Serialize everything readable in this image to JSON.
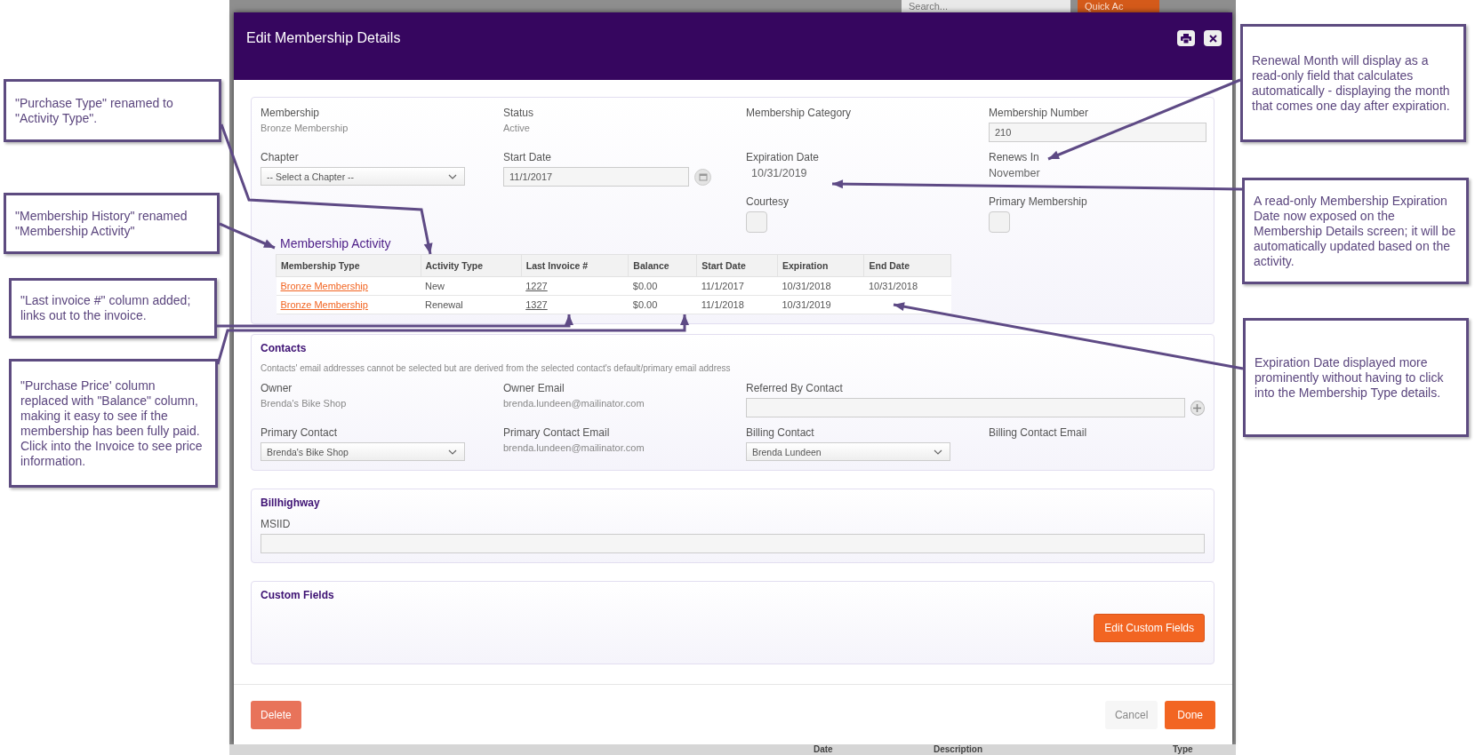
{
  "background": {
    "search_placeholder": "Search...",
    "quick_action": "Quick Ac",
    "table_headers": [
      "Date",
      "Description",
      "Type"
    ]
  },
  "modal": {
    "title": "Edit Membership Details"
  },
  "membership": {
    "rows": [
      [
        {
          "kind": "text",
          "label": "Membership",
          "value": "Bronze Membership"
        },
        {
          "kind": "text",
          "label": "Status",
          "value": "Active"
        },
        {
          "kind": "label",
          "label": "Membership Category"
        },
        {
          "kind": "input",
          "label": "Membership Number",
          "value": "210"
        }
      ],
      [
        {
          "kind": "select",
          "label": "Chapter",
          "value": "-- Select a Chapter --"
        },
        {
          "kind": "date",
          "label": "Start Date",
          "value": "11/1/2017"
        },
        {
          "kind": "readonly",
          "label": "Expiration Date",
          "value": "10/31/2019"
        },
        {
          "kind": "readonly",
          "label": "Renews In",
          "value": "November"
        }
      ],
      [
        "",
        "",
        {
          "kind": "checkbox",
          "label": "Courtesy",
          "checked": false
        },
        {
          "kind": "checkbox",
          "label": "Primary Membership",
          "checked": false
        }
      ]
    ]
  },
  "activity": {
    "title": "Membership Activity",
    "columns": [
      {
        "label": "Membership Type",
        "kind": "link"
      },
      {
        "label": "Activity Type",
        "kind": "text"
      },
      {
        "label": "Last Invoice #",
        "kind": "link"
      },
      {
        "label": "Balance",
        "kind": "text"
      },
      {
        "label": "Start Date",
        "kind": "text"
      },
      {
        "label": "Expiration",
        "kind": "text"
      },
      {
        "label": "End Date",
        "kind": "text"
      }
    ],
    "rows": [
      [
        "Bronze Membership",
        "New",
        "1227",
        "$0.00",
        "11/1/2017",
        "10/31/2018",
        "10/31/2018"
      ],
      [
        "Bronze Membership",
        "Renewal",
        "1327",
        "$0.00",
        "11/1/2018",
        "10/31/2019"
      ]
    ]
  },
  "contacts": {
    "title": "Contacts",
    "note": "Contacts' email addresses cannot be selected but are derived from the selected contact's default/primary email address",
    "rows": [
      [
        {
          "kind": "text",
          "label": "Owner",
          "value": "Brenda's Bike Shop"
        },
        {
          "kind": "text",
          "label": "Owner Email",
          "value": "brenda.lundeen@mailinator.com"
        },
        {
          "kind": "lookup",
          "label": "Referred By Contact"
        }
      ],
      [
        {
          "kind": "select",
          "label": "Primary Contact",
          "value": "Brenda's Bike Shop"
        },
        {
          "kind": "text",
          "label": "Primary Contact Email",
          "value": "brenda.lundeen@mailinator.com"
        },
        {
          "kind": "select",
          "label": "Billing Contact",
          "value": "Brenda Lundeen"
        },
        {
          "kind": "label",
          "label": "Billing Contact Email"
        }
      ]
    ]
  },
  "billhighway": {
    "title": "Billhighway",
    "field_label": "MSIID"
  },
  "custom_fields": {
    "title": "Custom Fields",
    "button": "Edit Custom Fields"
  },
  "footer": {
    "delete": "Delete",
    "cancel": "Cancel",
    "done": "Done"
  },
  "callouts_left": [
    "\"Purchase Type\" renamed to \"Activity Type\".",
    "\"Membership History\" renamed \"Membership Activity\"",
    "\"Last invoice #\" column added; links out to the invoice.",
    "\"Purchase Price' column replaced with \"Balance\" column, making it easy to see if the membership has been fully paid. Click into the Invoice to see price information."
  ],
  "callouts_right": [
    "Renewal Month will display as a read-only field that calculates automatically  - displaying the month that comes one day after expiration.",
    "A read-only Membership Expiration Date now exposed on the Membership Details screen; it will be automatically updated based on the activity.",
    "Expiration Date displayed more prominently without having to click into the Membership Type details."
  ]
}
